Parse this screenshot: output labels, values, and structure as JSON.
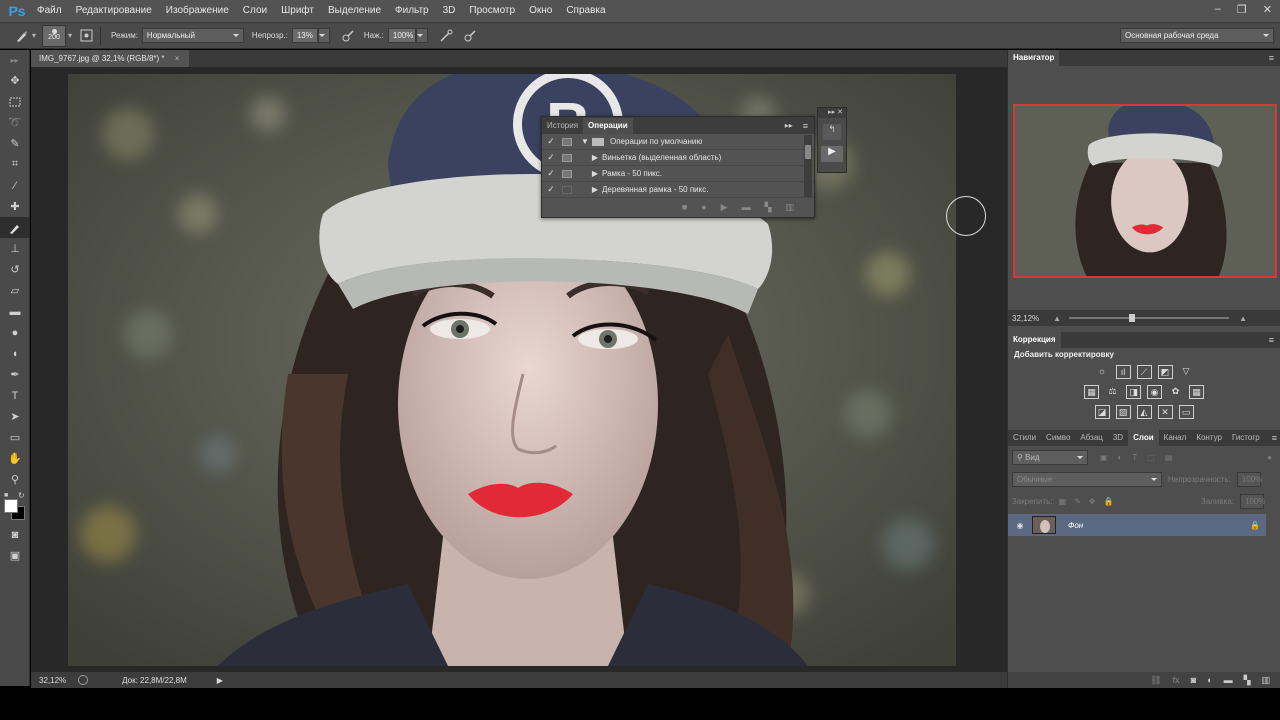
{
  "app": {
    "logo": "Ps"
  },
  "menu": [
    "Файл",
    "Редактирование",
    "Изображение",
    "Слои",
    "Шрифт",
    "Выделение",
    "Фильтр",
    "3D",
    "Просмотр",
    "Окно",
    "Справка"
  ],
  "window_controls": {
    "minimize": "–",
    "restore": "❐",
    "close": "✕"
  },
  "options": {
    "brush_size": "200",
    "mode_label": "Режим:",
    "mode_value": "Нормальный",
    "opacity_label": "Непрозр.:",
    "opacity_value": "13%",
    "pressure_label": "Наж.:",
    "pressure_value": "100%",
    "workspace": "Основная рабочая среда"
  },
  "document": {
    "tab_title": "IMG_9767.jpg @ 32,1% (RGB/8*) *",
    "tab_close": "×",
    "zoom": "32,12%",
    "doc_info": "Док: 22,8M/22,8M"
  },
  "actions_panel": {
    "tab_history": "История",
    "tab_actions": "Операции",
    "set_name": "Операции по умолчанию",
    "items": [
      "Виньетка (выделенная область)",
      "Рамка - 50 пикс.",
      "Деревянная рамка - 50 пикс."
    ]
  },
  "navigator": {
    "title": "Навигатор",
    "zoom": "32,12%"
  },
  "correction": {
    "title": "Коррекция",
    "subtitle": "Добавить корректировку"
  },
  "layers_panel": {
    "tabs": [
      "Стили",
      "Симво",
      "Абзац",
      "3D",
      "Слои",
      "Канал",
      "Контур",
      "Гистогр"
    ],
    "active_tab": "Слои",
    "filter_kind": "Вид",
    "blend_mode": "Обычные",
    "opacity_label": "Непрозрачность:",
    "opacity_value": "100%",
    "lock_label": "Закрепить:",
    "fill_label": "Заливка:",
    "fill_value": "100%",
    "layer_name": "Фон"
  },
  "colors": {
    "ps_blue": "#3aa0e8",
    "layer_selected": "#5b6a82",
    "navigator_frame": "#e0343a",
    "lips": "#e12a36"
  }
}
